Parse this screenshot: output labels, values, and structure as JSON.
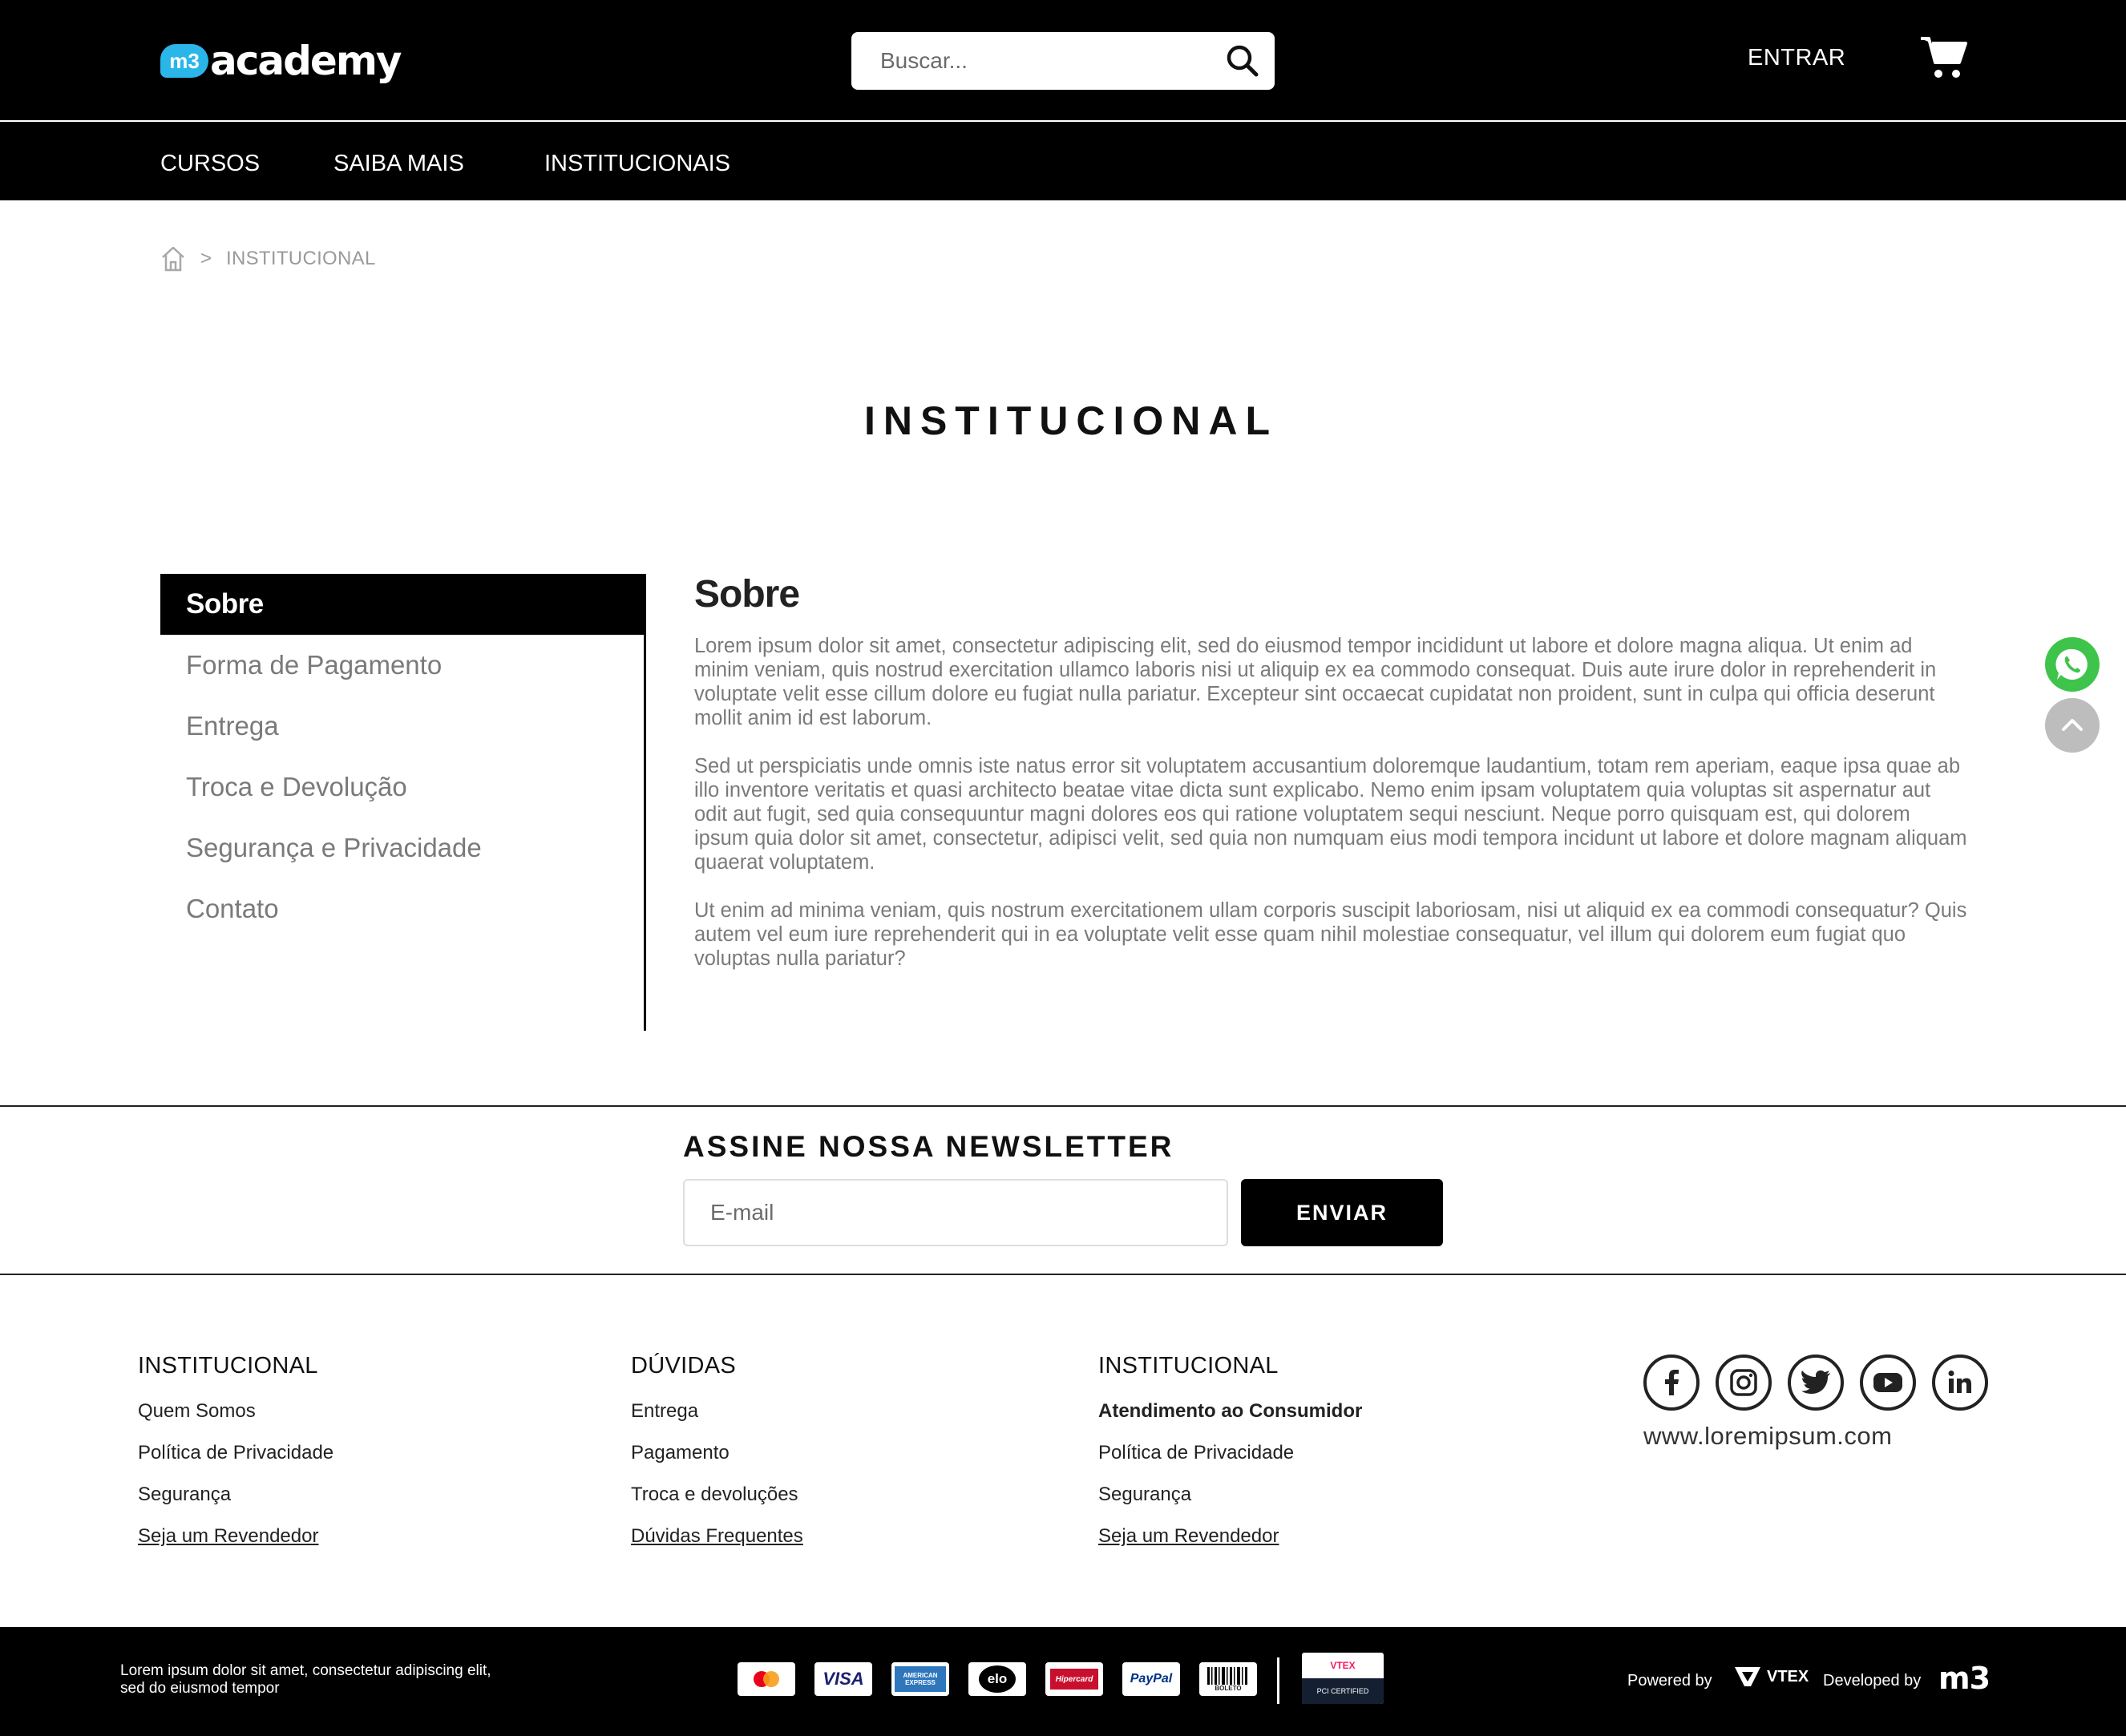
{
  "header": {
    "logo_badge": "m3",
    "logo_text": "academy",
    "search_placeholder": "Buscar...",
    "login_label": "ENTRAR",
    "icons": [
      "search-icon",
      "cart-icon"
    ]
  },
  "nav": {
    "items": [
      "CURSOS",
      "SAIBA MAIS",
      "INSTITUCIONAIS"
    ]
  },
  "breadcrumb": {
    "separator": ">",
    "current": "INSTITUCIONAL"
  },
  "page_title": "INSTITUCIONAL",
  "sidebar": {
    "items": [
      "Sobre",
      "Forma de Pagamento",
      "Entrega",
      "Troca e Devolução",
      "Segurança e Privacidade",
      "Contato"
    ],
    "active": "Sobre"
  },
  "content": {
    "heading": "Sobre",
    "paragraphs": [
      "Lorem ipsum dolor sit amet, consectetur adipiscing elit, sed do eiusmod tempor incididunt ut labore et dolore magna aliqua. Ut enim ad minim veniam, quis nostrud exercitation ullamco laboris nisi ut aliquip ex ea commodo consequat. Duis aute irure dolor in reprehenderit in voluptate velit esse cillum dolore eu fugiat nulla pariatur. Excepteur sint occaecat cupidatat non proident, sunt in culpa qui officia deserunt mollit anim id est laborum.",
      "Sed ut perspiciatis unde omnis iste natus error sit voluptatem accusantium doloremque laudantium, totam rem aperiam, eaque ipsa quae ab illo inventore veritatis et quasi architecto beatae vitae dicta sunt explicabo. Nemo enim ipsam voluptatem quia voluptas sit aspernatur aut odit aut fugit, sed quia consequuntur magni dolores eos qui ratione voluptatem sequi nesciunt. Neque porro quisquam est, qui dolorem ipsum quia dolor sit amet, consectetur, adipisci velit, sed quia non numquam eius modi tempora incidunt ut labore et dolore magnam aliquam quaerat voluptatem.",
      "Ut enim ad minima veniam, quis nostrum exercitationem ullam corporis suscipit laboriosam, nisi ut aliquid ex ea commodi consequatur? Quis autem vel eum iure reprehenderit qui in ea voluptate velit esse quam nihil molestiae consequatur, vel illum qui dolorem eum fugiat quo voluptas nulla pariatur?"
    ]
  },
  "floating": {
    "icons": [
      "whatsapp-icon",
      "chevron-up-icon"
    ],
    "whatsapp_color": "#3ec44b"
  },
  "newsletter": {
    "title": "ASSINE NOSSA NEWSLETTER",
    "email_placeholder": "E-mail",
    "button_label": "ENVIAR"
  },
  "footer": {
    "columns": [
      {
        "title": "INSTITUCIONAL",
        "links": [
          "Quem Somos",
          "Política de Privacidade",
          "Segurança",
          "Seja um Revendedor"
        ]
      },
      {
        "title": "DÚVIDAS",
        "links": [
          "Entrega",
          "Pagamento",
          "Troca e devoluções",
          "Dúvidas Frequentes"
        ]
      },
      {
        "title": "INSTITUCIONAL",
        "links": [
          "Atendimento ao Consumidor",
          "Política de Privacidade",
          "Segurança",
          "Seja um Revendedor"
        ]
      }
    ],
    "social_icons": [
      "facebook-icon",
      "instagram-icon",
      "twitter-icon",
      "youtube-icon",
      "linkedin-icon"
    ],
    "website": "www.loremipsum.com"
  },
  "bottom": {
    "text": "Lorem ipsum dolor sit amet, consectetur adipiscing elit, sed do eiusmod tempor",
    "payments": {
      "visa": "VISA",
      "amex": "AMERICAN EXPRESS",
      "elo": "elo",
      "hipercard": "Hipercard",
      "paypal": "PayPal",
      "boleto": "BOLETO"
    },
    "vtex_cert_top": "VTEX",
    "vtex_cert_bottom": "PCI CERTIFIED",
    "powered_by": "Powered by",
    "vtex_label": "VTEX",
    "developed_by": "Developed by",
    "m3_label": "m3"
  }
}
